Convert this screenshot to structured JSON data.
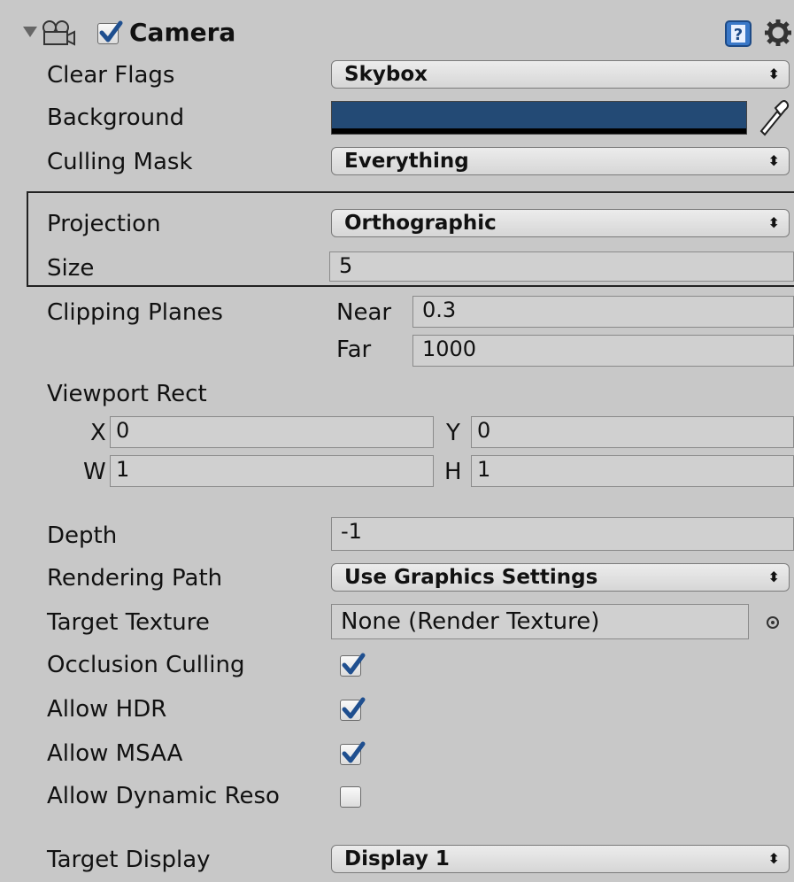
{
  "component": {
    "title": "Camera",
    "enabled": true,
    "icons": {
      "foldout": "triangle-down-icon",
      "component": "camera-icon",
      "help": "help-icon",
      "settings": "gear-icon"
    }
  },
  "fields": {
    "clear_flags": {
      "label": "Clear Flags",
      "value": "Skybox"
    },
    "background": {
      "label": "Background",
      "color": "#234a75"
    },
    "culling_mask": {
      "label": "Culling Mask",
      "value": "Everything"
    },
    "projection": {
      "label": "Projection",
      "value": "Orthographic"
    },
    "size": {
      "label": "Size",
      "value": "5"
    },
    "clipping_planes": {
      "label": "Clipping Planes",
      "near_label": "Near",
      "near_value": "0.3",
      "far_label": "Far",
      "far_value": "1000"
    },
    "viewport_rect": {
      "label": "Viewport Rect",
      "x_label": "X",
      "x_value": "0",
      "y_label": "Y",
      "y_value": "0",
      "w_label": "W",
      "w_value": "1",
      "h_label": "H",
      "h_value": "1"
    },
    "depth": {
      "label": "Depth",
      "value": "-1"
    },
    "rendering_path": {
      "label": "Rendering Path",
      "value": "Use Graphics Settings"
    },
    "target_texture": {
      "label": "Target Texture",
      "value": "None (Render Texture)"
    },
    "occlusion_culling": {
      "label": "Occlusion Culling",
      "checked": true
    },
    "allow_hdr": {
      "label": "Allow HDR",
      "checked": true
    },
    "allow_msaa": {
      "label": "Allow MSAA",
      "checked": true
    },
    "allow_dynamic_reso": {
      "label": "Allow Dynamic Reso",
      "checked": false
    },
    "target_display": {
      "label": "Target Display",
      "value": "Display 1"
    }
  },
  "colors": {
    "panel": "#c8c8c8",
    "checkmark": "#1f4f8f",
    "background_swatch": "#234a75"
  }
}
